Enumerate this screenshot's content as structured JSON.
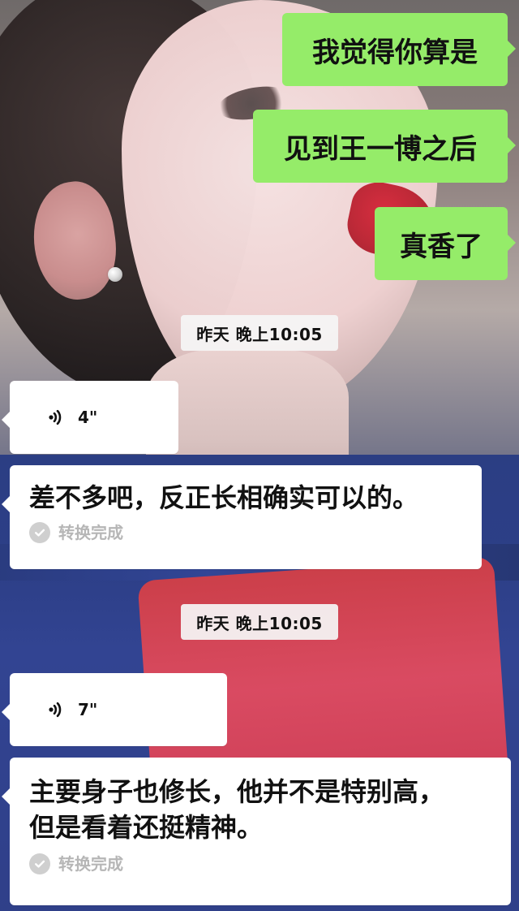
{
  "messages": {
    "sent": [
      "我觉得你算是",
      "见到王一博之后",
      "真香了"
    ],
    "timestamps": [
      "昨天 晚上10:05",
      "昨天 晚上10:05"
    ],
    "voice_1": {
      "duration": "4\"",
      "transcript": "差不多吧，反正长相确实可以的。",
      "status": "转换完成"
    },
    "voice_2": {
      "duration": "7\"",
      "transcript_line1": "主要身子也修长，他并不是特别高，",
      "transcript_line2": "但是看着还挺精神。",
      "status": "转换完成"
    }
  },
  "colors": {
    "sent_bubble": "#95ec69",
    "received_bubble": "#ffffff",
    "timestamp_bg": "#f5f5f5",
    "status_gray": "#b6b6b6"
  },
  "icons": {
    "voice": "voice-wave-icon",
    "check": "check-circle-icon"
  }
}
